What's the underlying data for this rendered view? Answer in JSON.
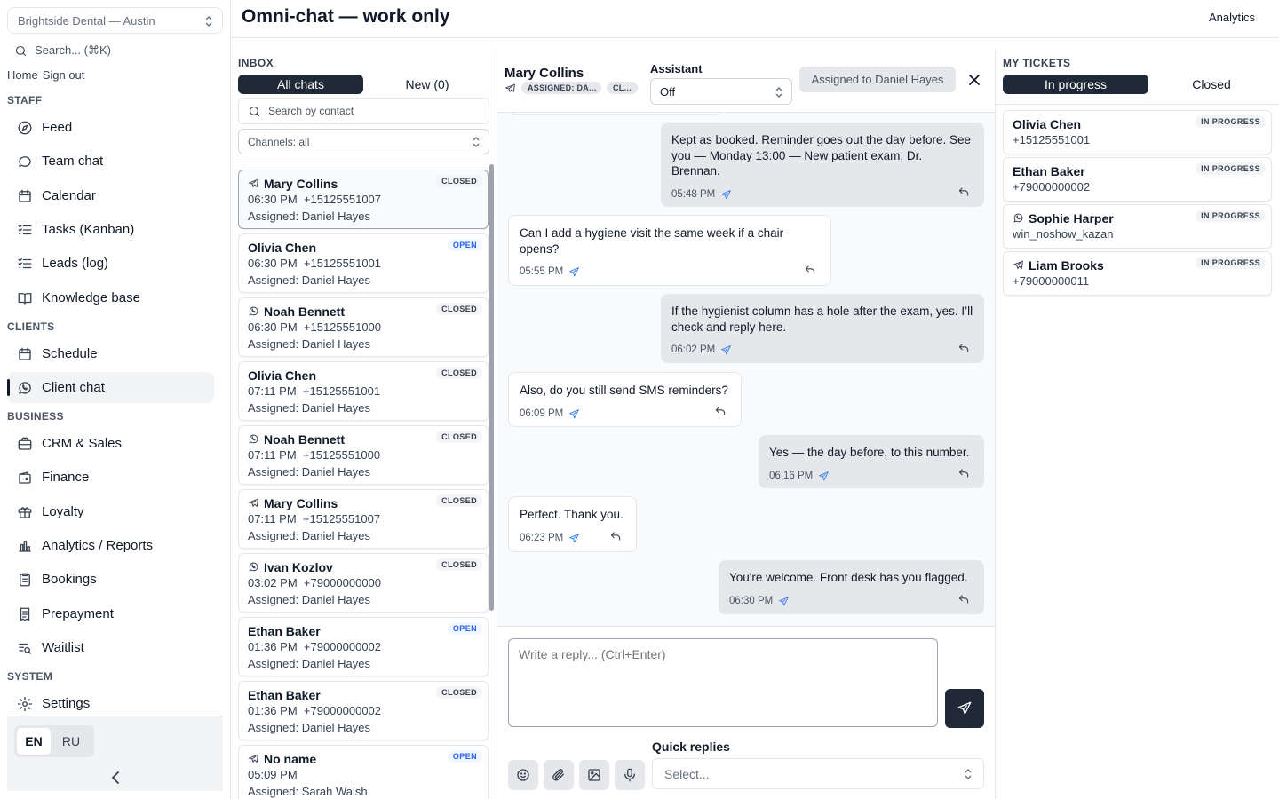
{
  "sidebar": {
    "org": "Brightside Dental — Austin",
    "search_placeholder": "Search... (⌘K)",
    "links": {
      "home": "Home",
      "signout": "Sign out"
    },
    "sections": {
      "staff": "STAFF",
      "clients": "CLIENTS",
      "business": "BUSINESS",
      "system": "SYSTEM"
    },
    "items": [
      {
        "label": "Feed",
        "icon": "compass-icon"
      },
      {
        "label": "Team chat",
        "icon": "chat-bubble-icon"
      },
      {
        "label": "Calendar",
        "icon": "calendar-icon"
      },
      {
        "label": "Tasks (Kanban)",
        "icon": "list-checks-icon"
      },
      {
        "label": "Leads (log)",
        "icon": "list-checks-icon"
      },
      {
        "label": "Knowledge base",
        "icon": "book-icon"
      },
      {
        "label": "Schedule",
        "icon": "calendar-icon"
      },
      {
        "label": "Client chat",
        "icon": "whatsapp-icon",
        "active": true
      },
      {
        "label": "CRM & Sales",
        "icon": "briefcase-icon"
      },
      {
        "label": "Finance",
        "icon": "wallet-icon"
      },
      {
        "label": "Loyalty",
        "icon": "gift-icon"
      },
      {
        "label": "Analytics / Reports",
        "icon": "bar-chart-icon"
      },
      {
        "label": "Bookings",
        "icon": "clipboard-icon"
      },
      {
        "label": "Prepayment",
        "icon": "receipt-icon"
      },
      {
        "label": "Waitlist",
        "icon": "list-search-icon"
      },
      {
        "label": "Settings",
        "icon": "gear-icon"
      }
    ],
    "languages": [
      "EN",
      "RU"
    ],
    "active_language": "EN"
  },
  "header": {
    "title": "Omni‑chat — work only",
    "analytics": "Analytics"
  },
  "inbox": {
    "title": "INBOX",
    "tabs": [
      "All chats",
      "New (0)"
    ],
    "search_placeholder": "Search by contact",
    "channel_filter": "Channels: all",
    "chats": [
      {
        "name": "Mary Collins",
        "channel": "telegram",
        "time": "06:30 PM",
        "phone": "+15125551007",
        "assigned": "Assigned: Daniel Hayes",
        "status": "CLOSED",
        "selected": true
      },
      {
        "name": "Olivia Chen",
        "channel": "",
        "time": "06:30 PM",
        "phone": "+15125551001",
        "assigned": "Assigned: Daniel Hayes",
        "status": "OPEN"
      },
      {
        "name": "Noah Bennett",
        "channel": "whatsapp",
        "time": "06:30 PM",
        "phone": "+15125551000",
        "assigned": "Assigned: Daniel Hayes",
        "status": "CLOSED"
      },
      {
        "name": "Olivia Chen",
        "channel": "",
        "time": "07:11 PM",
        "phone": "+15125551001",
        "assigned": "Assigned: Daniel Hayes",
        "status": "CLOSED"
      },
      {
        "name": "Noah Bennett",
        "channel": "whatsapp",
        "time": "07:11 PM",
        "phone": "+15125551000",
        "assigned": "Assigned: Daniel Hayes",
        "status": "CLOSED"
      },
      {
        "name": "Mary Collins",
        "channel": "telegram",
        "time": "07:11 PM",
        "phone": "+15125551007",
        "assigned": "Assigned: Daniel Hayes",
        "status": "CLOSED"
      },
      {
        "name": "Ivan Kozlov",
        "channel": "whatsapp",
        "time": "03:02 PM",
        "phone": "+79000000000",
        "assigned": "Assigned: Daniel Hayes",
        "status": "CLOSED"
      },
      {
        "name": "Ethan Baker",
        "channel": "",
        "time": "01:36 PM",
        "phone": "+79000000002",
        "assigned": "Assigned: Daniel Hayes",
        "status": "OPEN"
      },
      {
        "name": "Ethan Baker",
        "channel": "",
        "time": "01:36 PM",
        "phone": "+79000000002",
        "assigned": "Assigned: Daniel Hayes",
        "status": "CLOSED"
      },
      {
        "name": "No name",
        "channel": "telegram",
        "time": "05:09 PM",
        "phone": "",
        "assigned": "Assigned: Sarah Walsh",
        "status": "OPEN"
      }
    ]
  },
  "conversation": {
    "contact": "Mary Collins",
    "tags": [
      "ASSIGNED: DA...",
      "CL..."
    ],
    "assistant_label": "Assistant",
    "assistant_value": "Off",
    "assigned_button": "Assigned to Daniel Hayes",
    "messages": [
      {
        "dir": "out",
        "text": "Kept as booked. Reminder goes out the day before. See you — Monday 13:00 — New patient exam, Dr. Brennan.",
        "time": "05:48 PM"
      },
      {
        "dir": "in",
        "text": "Can I add a hygiene visit the same week if a chair opens?",
        "time": "05:55 PM"
      },
      {
        "dir": "out",
        "text": "If the hygienist column has a hole after the exam, yes. I’ll check and reply here.",
        "time": "06:02 PM"
      },
      {
        "dir": "in",
        "text": "Also, do you still send SMS reminders?",
        "time": "06:09 PM"
      },
      {
        "dir": "out",
        "text": "Yes — the day before, to this number.",
        "time": "06:16 PM"
      },
      {
        "dir": "in",
        "text": "Perfect. Thank you.",
        "time": "06:23 PM"
      },
      {
        "dir": "out",
        "text": "You're welcome. Front desk has you flagged.",
        "time": "06:30 PM"
      }
    ],
    "reply_placeholder": "Write a reply... (Ctrl+Enter)",
    "quick_replies_label": "Quick replies",
    "quick_replies_placeholder": "Select..."
  },
  "tickets": {
    "title": "MY TICKETS",
    "tabs": [
      "In progress",
      "Closed"
    ],
    "items": [
      {
        "name": "Olivia Chen",
        "channel": "",
        "sub": "+15125551001",
        "status": "IN PROGRESS"
      },
      {
        "name": "Ethan Baker",
        "channel": "",
        "sub": "+79000000002",
        "status": "IN PROGRESS"
      },
      {
        "name": "Sophie Harper",
        "channel": "whatsapp",
        "sub": "win_noshow_kazan",
        "status": "IN PROGRESS"
      },
      {
        "name": "Liam Brooks",
        "channel": "telegram",
        "sub": "+79000000011",
        "status": "IN PROGRESS"
      }
    ]
  },
  "colors": {
    "primary": "#1f2937",
    "accent_blue": "#3b82f6",
    "border": "#e5e7eb",
    "outgoing_bubble": "#e5e7eb"
  }
}
